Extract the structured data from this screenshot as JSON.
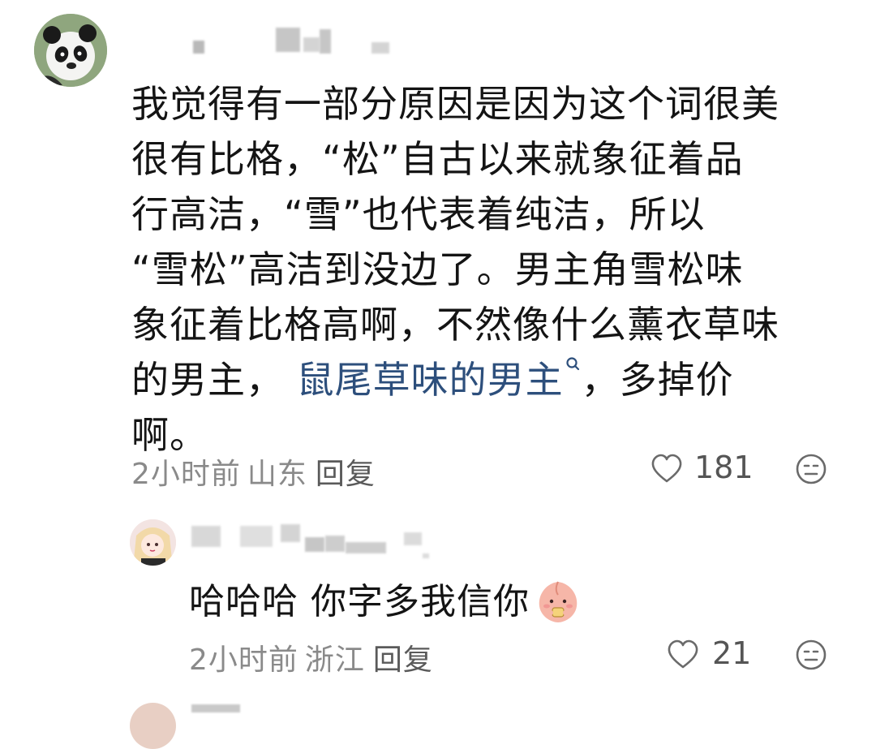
{
  "main_comment": {
    "author_name": "",
    "avatar_icon": "panda-avatar-icon",
    "text_lines": [
      "我觉得有一部分原因是因为这个词很美",
      "很有比格，“松”自古以来就象征着品",
      "行高洁，“雪”也代表着纯洁，所以",
      "“雪松”高洁到没边了。男主角雪松味",
      "象征着比格高啊，不然像什么薰衣草味"
    ],
    "line6_before": "的男主，",
    "line6_link": "鼠尾草味的男主",
    "line6_after": "，多掉价",
    "line7": "啊。",
    "time": "2小时前",
    "location": "山东",
    "reply_label": "回复",
    "like_count": "181"
  },
  "reply_comment": {
    "author_name": "",
    "avatar_icon": "anime-girl-avatar-icon",
    "text": "哈哈哈 你字多我信你",
    "emoji_icon": "peach-emoji-icon",
    "time": "2小时前",
    "location": "浙江",
    "reply_label": "回复",
    "like_count": "21"
  },
  "colors": {
    "text": "#141414",
    "meta": "#8a8a8a",
    "link": "#2d4f7c",
    "icon": "#6a6a6a"
  }
}
